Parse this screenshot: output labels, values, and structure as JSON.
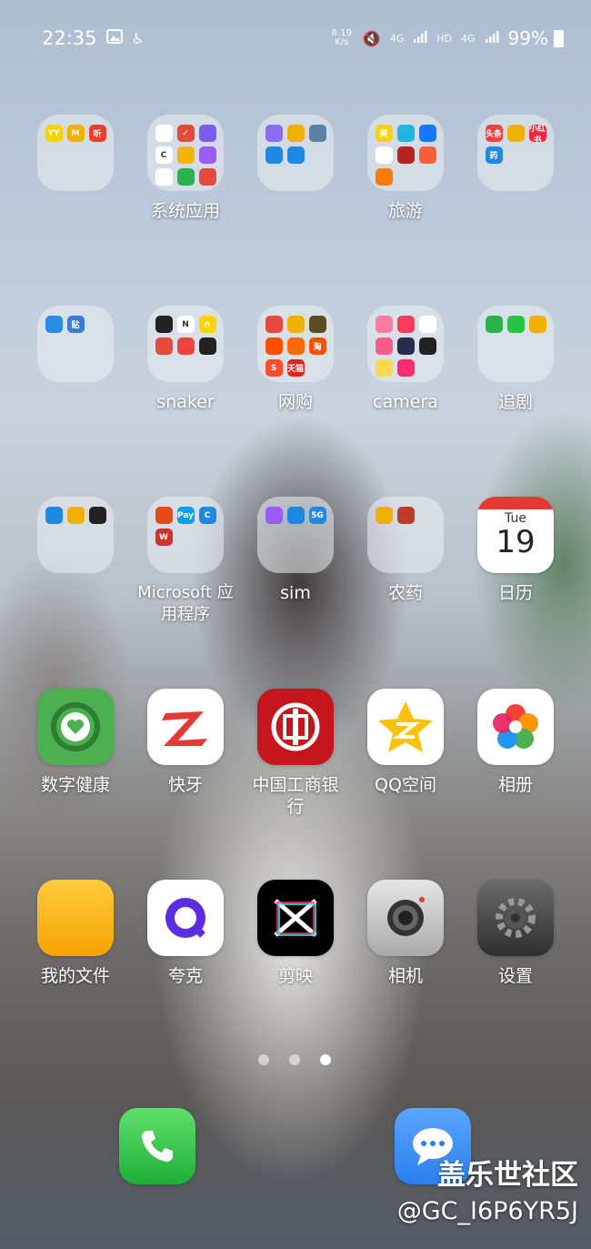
{
  "status_bar": {
    "time": "22:35",
    "net_speed": "8.19 K/s",
    "network": "4G",
    "hd": "HD",
    "network2": "4G",
    "battery": "99%"
  },
  "apps": {
    "folder1": {
      "label": "",
      "minis": [
        {
          "t": "YY",
          "c": "#f5d200"
        },
        {
          "t": "M",
          "c": "#f0b000"
        },
        {
          "t": "听",
          "c": "#e6412f"
        }
      ]
    },
    "system_apps": {
      "label": "系统应用",
      "minis": [
        {
          "t": "",
          "c": "#ffffff"
        },
        {
          "t": "✓",
          "c": "#e64a3b"
        },
        {
          "t": "",
          "c": "#7b5cf0"
        },
        {
          "t": "C",
          "c": "#ffffff"
        },
        {
          "t": "",
          "c": "#f3b300"
        },
        {
          "t": "",
          "c": "#9a5cf5"
        },
        {
          "t": "",
          "c": "#ffffff"
        },
        {
          "t": "",
          "c": "#2bb24c"
        },
        {
          "t": "",
          "c": "#e64a3b"
        }
      ]
    },
    "folder3": {
      "label": "",
      "minis": [
        {
          "t": "",
          "c": "#8a6cf0"
        },
        {
          "t": "",
          "c": "#f0b000"
        },
        {
          "t": "",
          "c": "#5c7fa6"
        },
        {
          "t": "",
          "c": "#1e88e5"
        },
        {
          "t": "",
          "c": "#1e88e5"
        }
      ]
    },
    "travel": {
      "label": "旅游",
      "minis": [
        {
          "t": "美",
          "c": "#ffd100"
        },
        {
          "t": "",
          "c": "#1fb6e6"
        },
        {
          "t": "",
          "c": "#1677ff"
        },
        {
          "t": "",
          "c": "#ffffff"
        },
        {
          "t": "",
          "c": "#b8231d"
        },
        {
          "t": "",
          "c": "#ff5e3a"
        },
        {
          "t": "",
          "c": "#ff7a00"
        }
      ]
    },
    "folder5": {
      "label": "",
      "minis": [
        {
          "t": "头条",
          "c": "#f04142"
        },
        {
          "t": "",
          "c": "#f0b000"
        },
        {
          "t": "小红书",
          "c": "#ff2442"
        },
        {
          "t": "药",
          "c": "#1e88e5"
        }
      ]
    },
    "folder6": {
      "label": "",
      "minis": [
        {
          "t": "",
          "c": "#2b8be6"
        },
        {
          "t": "贴",
          "c": "#3a7bd5"
        }
      ]
    },
    "snaker": {
      "label": "snaker",
      "minis": [
        {
          "t": "",
          "c": "#222222"
        },
        {
          "t": "N",
          "c": "#ffffff"
        },
        {
          "t": "n",
          "c": "#ffd400"
        },
        {
          "t": "",
          "c": "#e64a3b"
        },
        {
          "t": "",
          "c": "#f04142"
        },
        {
          "t": "",
          "c": "#222222"
        }
      ]
    },
    "shopping": {
      "label": "网购",
      "minis": [
        {
          "t": "",
          "c": "#e64a3b"
        },
        {
          "t": "",
          "c": "#f0b000"
        },
        {
          "t": "",
          "c": "#5d4b21"
        },
        {
          "t": "",
          "c": "#ff5000"
        },
        {
          "t": "",
          "c": "#ff6a00"
        },
        {
          "t": "淘",
          "c": "#ff5000"
        },
        {
          "t": "S",
          "c": "#ff4d2e"
        },
        {
          "t": "天猫",
          "c": "#e1251b"
        }
      ]
    },
    "camera": {
      "label": "camera",
      "minis": [
        {
          "t": "",
          "c": "#ff7aa2"
        },
        {
          "t": "",
          "c": "#ff3b5c"
        },
        {
          "t": "",
          "c": "#ffffff"
        },
        {
          "t": "",
          "c": "#ff5a8a"
        },
        {
          "t": "",
          "c": "#2a2a4a"
        },
        {
          "t": "",
          "c": "#222222"
        },
        {
          "t": "",
          "c": "#ffd84a"
        },
        {
          "t": "",
          "c": "#ff2d6f"
        }
      ]
    },
    "drama": {
      "label": "追剧",
      "minis": [
        {
          "t": "",
          "c": "#2bb24c"
        },
        {
          "t": "",
          "c": "#23c343"
        },
        {
          "t": "",
          "c": "#f0b000"
        }
      ]
    },
    "folder11": {
      "label": "",
      "minis": [
        {
          "t": "",
          "c": "#1e88e5"
        },
        {
          "t": "",
          "c": "#f0b000"
        },
        {
          "t": "",
          "c": "#222222"
        }
      ]
    },
    "microsoft": {
      "label": "Microsoft 应用程序",
      "minis": [
        {
          "t": "",
          "c": "#e64a19"
        },
        {
          "t": "Pay",
          "c": "#00a1e9"
        },
        {
          "t": "C",
          "c": "#1e88e5"
        },
        {
          "t": "W",
          "c": "#d32f2f"
        }
      ]
    },
    "sim": {
      "label": "sim",
      "minis": [
        {
          "t": "",
          "c": "#9a5cf5"
        },
        {
          "t": "",
          "c": "#1e88e5"
        },
        {
          "t": "5G",
          "c": "#1e88e5"
        }
      ]
    },
    "pesticide": {
      "label": "农药",
      "minis": [
        {
          "t": "",
          "c": "#f0b000"
        },
        {
          "t": "",
          "c": "#c0392b"
        }
      ]
    },
    "calendar": {
      "label": "日历",
      "day": "Tue",
      "date": "19"
    },
    "health": {
      "label": "数字健康"
    },
    "kuaiya": {
      "label": "快牙"
    },
    "icbc": {
      "label": "中国工商银行"
    },
    "qzone": {
      "label": "QQ空间"
    },
    "gallery": {
      "label": "相册"
    },
    "files": {
      "label": "我的文件"
    },
    "quark": {
      "label": "夸克"
    },
    "capcut": {
      "label": "剪映"
    },
    "camera_app": {
      "label": "相机"
    },
    "settings": {
      "label": "设置"
    }
  },
  "page_indicator": {
    "total": 3,
    "current": 3
  },
  "watermark": {
    "site": "盖乐世社区",
    "user": "@GC_I6P6YR5J"
  }
}
